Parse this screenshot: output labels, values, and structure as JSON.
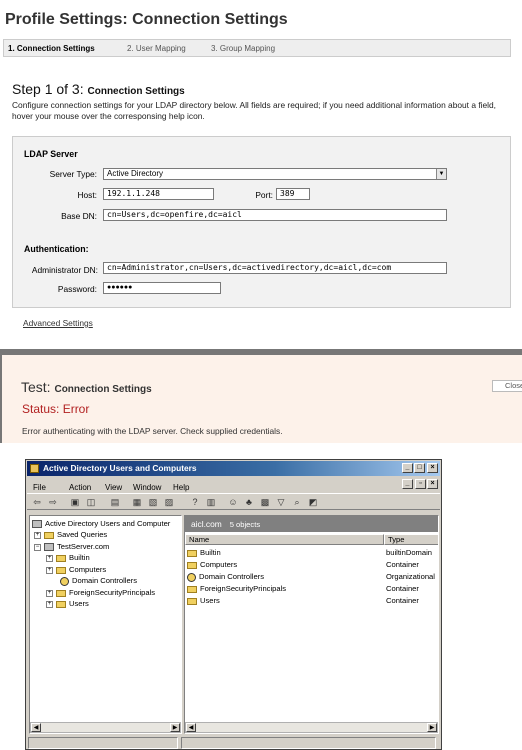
{
  "profile": {
    "title": "Profile Settings: Connection Settings",
    "steps": [
      "1. Connection Settings",
      "2. User Mapping",
      "3. Group Mapping"
    ],
    "step_heading": "Step 1 of 3:",
    "step_heading_small": "Connection Settings",
    "description": "Configure connection settings for your LDAP directory below. All fields are required; if you need additional information about a field, hover your mouse over the corresponsing help icon.",
    "ldap_section": "LDAP Server",
    "server_type_label": "Server Type:",
    "server_type_value": "Active Directory",
    "host_label": "Host:",
    "host_value": "192.1.1.248",
    "port_label": "Port:",
    "port_value": "389",
    "base_dn_label": "Base DN:",
    "base_dn_value": "cn=Users,dc=openfire,dc=aicl",
    "auth_section": "Authentication:",
    "admin_dn_label": "Administrator DN:",
    "admin_dn_value": "cn=Administrator,cn=Users,dc=activedirectory,dc=aicl,dc=com",
    "password_label": "Password:",
    "password_value": "●●●●●●",
    "advanced_link": "Advanced Settings"
  },
  "test": {
    "title": "Test:",
    "title_small": "Connection Settings",
    "close_label": "Close",
    "status": "Status: Error",
    "message": "Error authenticating with the LDAP server. Check supplied credentials."
  },
  "aduc": {
    "window_title": "Active Directory Users and Computers",
    "menu": [
      "File",
      "Action",
      "View",
      "Window",
      "Help"
    ],
    "tree": {
      "root": "Active Directory Users and Computer",
      "saved_queries": "Saved Queries",
      "domain": "TestServer.com",
      "children": [
        "Builtin",
        "Computers",
        "Domain Controllers",
        "ForeignSecurityPrincipals",
        "Users"
      ]
    },
    "list": {
      "header": "aicl.com",
      "count": "5 objects",
      "col_name": "Name",
      "col_type": "Type",
      "rows": [
        {
          "name": "Builtin",
          "type": "builtinDomain"
        },
        {
          "name": "Computers",
          "type": "Container"
        },
        {
          "name": "Domain Controllers",
          "type": "Organizational"
        },
        {
          "name": "ForeignSecurityPrincipals",
          "type": "Container"
        },
        {
          "name": "Users",
          "type": "Container"
        }
      ]
    },
    "colors": {
      "titlebar": "#0a246a",
      "folder": "#f0d060"
    }
  }
}
